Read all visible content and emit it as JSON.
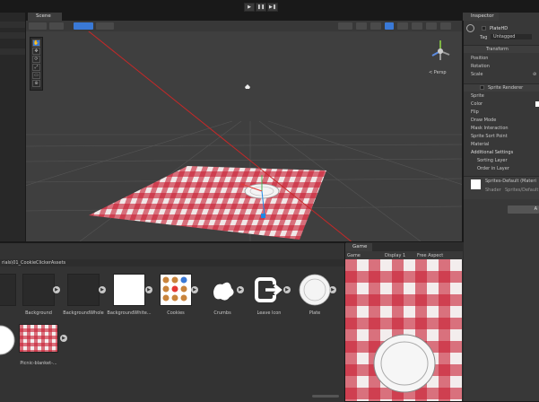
{
  "toolbar": {
    "play_icon": "play-icon",
    "pause_icon": "pause-icon",
    "step_icon": "step-icon",
    "play": "▶",
    "pause": "❚❚",
    "step": "▶❚"
  },
  "hierarchy": {
    "rows": [
      "",
      "",
      ""
    ]
  },
  "scene": {
    "tab_label": "Scene",
    "persp_label": "< Persp",
    "tools": [
      "✋",
      "✥",
      "⟳",
      "⤢",
      "▭",
      "⊕"
    ]
  },
  "inspector": {
    "tab_label": "Inspector",
    "object_name": "PlateHD",
    "tag_label": "Tag",
    "tag_value": "Untagged",
    "transform_header": "Transform",
    "position_label": "Position",
    "rotation_label": "Rotation",
    "scale_label": "Scale",
    "scale_value": "⊘",
    "sprite_renderer_header": "Sprite Renderer",
    "fields": [
      "Sprite",
      "Color",
      "Flip",
      "Draw Mode",
      "Mask Interaction",
      "Sprite Sort Point",
      "Material"
    ],
    "additional_settings": "Additional Settings",
    "sorting_layer": "Sorting Layer",
    "order_in_layer": "Order in Layer",
    "material_name": "Sprites-Default (Materi",
    "shader_label": "Shader",
    "shader_value": "Sprites/Default",
    "add_button": "A"
  },
  "project": {
    "path": "rials\\01_CookieClickerAssets",
    "assets": [
      {
        "label": "Background"
      },
      {
        "label": "BackgroundWhole"
      },
      {
        "label": "BackgroundWhite..."
      },
      {
        "label": "Cookies"
      },
      {
        "label": "Crumbs"
      },
      {
        "label": "Leave Icon"
      },
      {
        "label": "Plate"
      },
      {
        "label": "Picnic-blanket-..."
      }
    ]
  },
  "game": {
    "tab_label": "Game",
    "display_label": "Game",
    "display_value": "Display 1",
    "aspect_value": "Free Aspect"
  },
  "colors": {
    "accent_blue": "#3a79d6",
    "gingham_red": "#c81e32"
  }
}
